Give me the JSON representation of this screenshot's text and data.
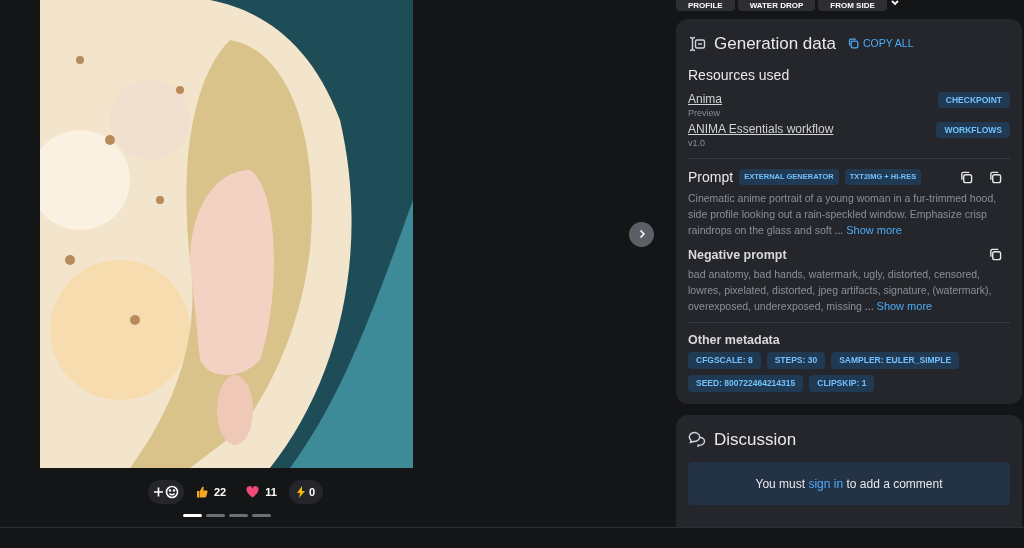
{
  "tags": [
    {
      "label": "PROFILE"
    },
    {
      "label": "WATER DROP"
    },
    {
      "label": "FROM SIDE"
    }
  ],
  "reactions": [
    {
      "kind": "add"
    },
    {
      "kind": "like",
      "count": "22"
    },
    {
      "kind": "heart",
      "count": "11"
    },
    {
      "kind": "buzz",
      "count": "0"
    }
  ],
  "carousel": [
    {
      "selected": true
    },
    {
      "selected": false
    },
    {
      "selected": false
    },
    {
      "selected": false
    }
  ],
  "generation": {
    "title": "Generation data",
    "copy_all": "COPY ALL",
    "resources_title": "Resources used",
    "resources": [
      {
        "name": "Anima",
        "version": "Preview",
        "type": "CHECKPOINT"
      },
      {
        "name": "ANIMA Essentials workflow",
        "version": "v1.0",
        "type": "WORKFLOWS"
      }
    ],
    "prompt": {
      "title": "Prompt",
      "badges": [
        "EXTERNAL GENERATOR",
        "TXT2IMG + HI-RES"
      ],
      "text": "Cinematic anime portrait of a young woman in a fur-trimmed hood, side profile looking out a rain-speckled window. Emphasize crisp raindrops on the glass and soft",
      "ellipsis": "...",
      "more": "Show more"
    },
    "negative": {
      "title": "Negative prompt",
      "text": "bad anatomy, bad hands, watermark, ugly, distorted, censored, lowres, pixelated, distorted, jpeg artifacts, signature, (watermark), overexposed, underexposed, missing",
      "ellipsis": "...",
      "more": "Show more"
    },
    "other_title": "Other metadata",
    "metadata": [
      "CFGSCALE: 8",
      "STEPS: 30",
      "SAMPLER: EULER_SIMPLE",
      "SEED: 800722464214315",
      "CLIPSKIP: 1"
    ]
  },
  "discussion": {
    "title": "Discussion",
    "before": "You must",
    "link": "sign in",
    "after": "to add a comment"
  }
}
